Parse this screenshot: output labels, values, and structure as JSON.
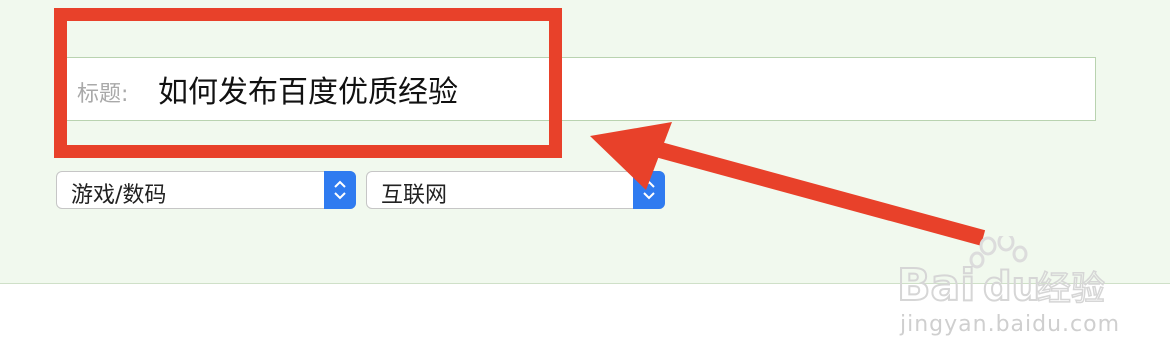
{
  "form": {
    "title_label": "标题:",
    "title_value": "如何发布百度优质经验",
    "category_primary": "游戏/数码",
    "category_secondary": "互联网"
  },
  "watermark": {
    "logo": "Bai du 经验",
    "url": "jingyan.baidu.com"
  },
  "colors": {
    "panel_bg": "#f1f9ee",
    "highlight_red": "#e8412a",
    "select_accent": "#2f7bf0"
  },
  "icons": {
    "select_arrow": "up-down-chevron-icon",
    "annotation": "arrow-annotation"
  }
}
